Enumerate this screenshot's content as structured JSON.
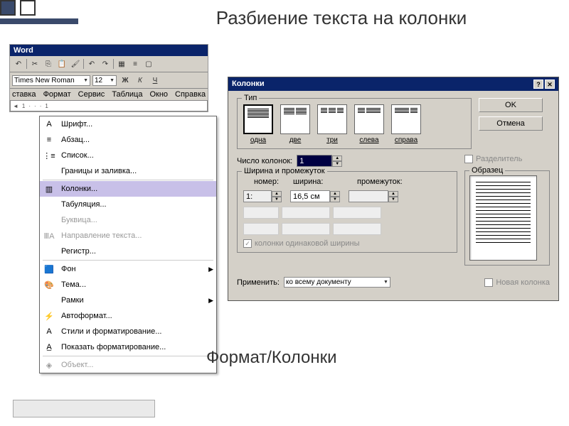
{
  "title_main": "Разбиение текста на колонки",
  "footer": "Формат/Колонки",
  "word": {
    "title": "Word",
    "font_name": "Times New Roman",
    "font_size": "12",
    "bold": "Ж",
    "italic": "К",
    "underline": "Ч"
  },
  "menubar": {
    "m1": "ставка",
    "m2": "Формат",
    "m3": "Сервис",
    "m4": "Таблица",
    "m5": "Окно",
    "m6": "Справка"
  },
  "menu": {
    "font": "Шрифт...",
    "para": "Абзац...",
    "list": "Список...",
    "borders": "Границы и заливка...",
    "columns": "Колонки...",
    "tabs": "Табуляция...",
    "dropcap": "Буквица...",
    "textdir": "Направление текста...",
    "register": "Регистр...",
    "bg": "Фон",
    "theme": "Тема...",
    "frames": "Рамки",
    "autoformat": "Автоформат...",
    "styles": "Стили и форматирование...",
    "reveal": "Показать форматирование...",
    "object": "Объект..."
  },
  "dialog": {
    "title": "Колонки",
    "type_label": "Тип",
    "t1": "одна",
    "t2": "две",
    "t3": "три",
    "t4": "слева",
    "t5": "справа",
    "ok": "OK",
    "cancel": "Отмена",
    "num_label": "Число колонок:",
    "num_value": "1",
    "separator": "Разделитель",
    "width_group": "Ширина и промежуток",
    "col_num": "номер:",
    "col_width": "ширина:",
    "col_gap": "промежуток:",
    "row1_num": "1:",
    "row1_width": "16,5 см",
    "equal": "колонки одинаковой ширины",
    "preview": "Образец",
    "apply_label": "Применить:",
    "apply_value": "ко всему документу",
    "new_col": "Новая колонка"
  }
}
